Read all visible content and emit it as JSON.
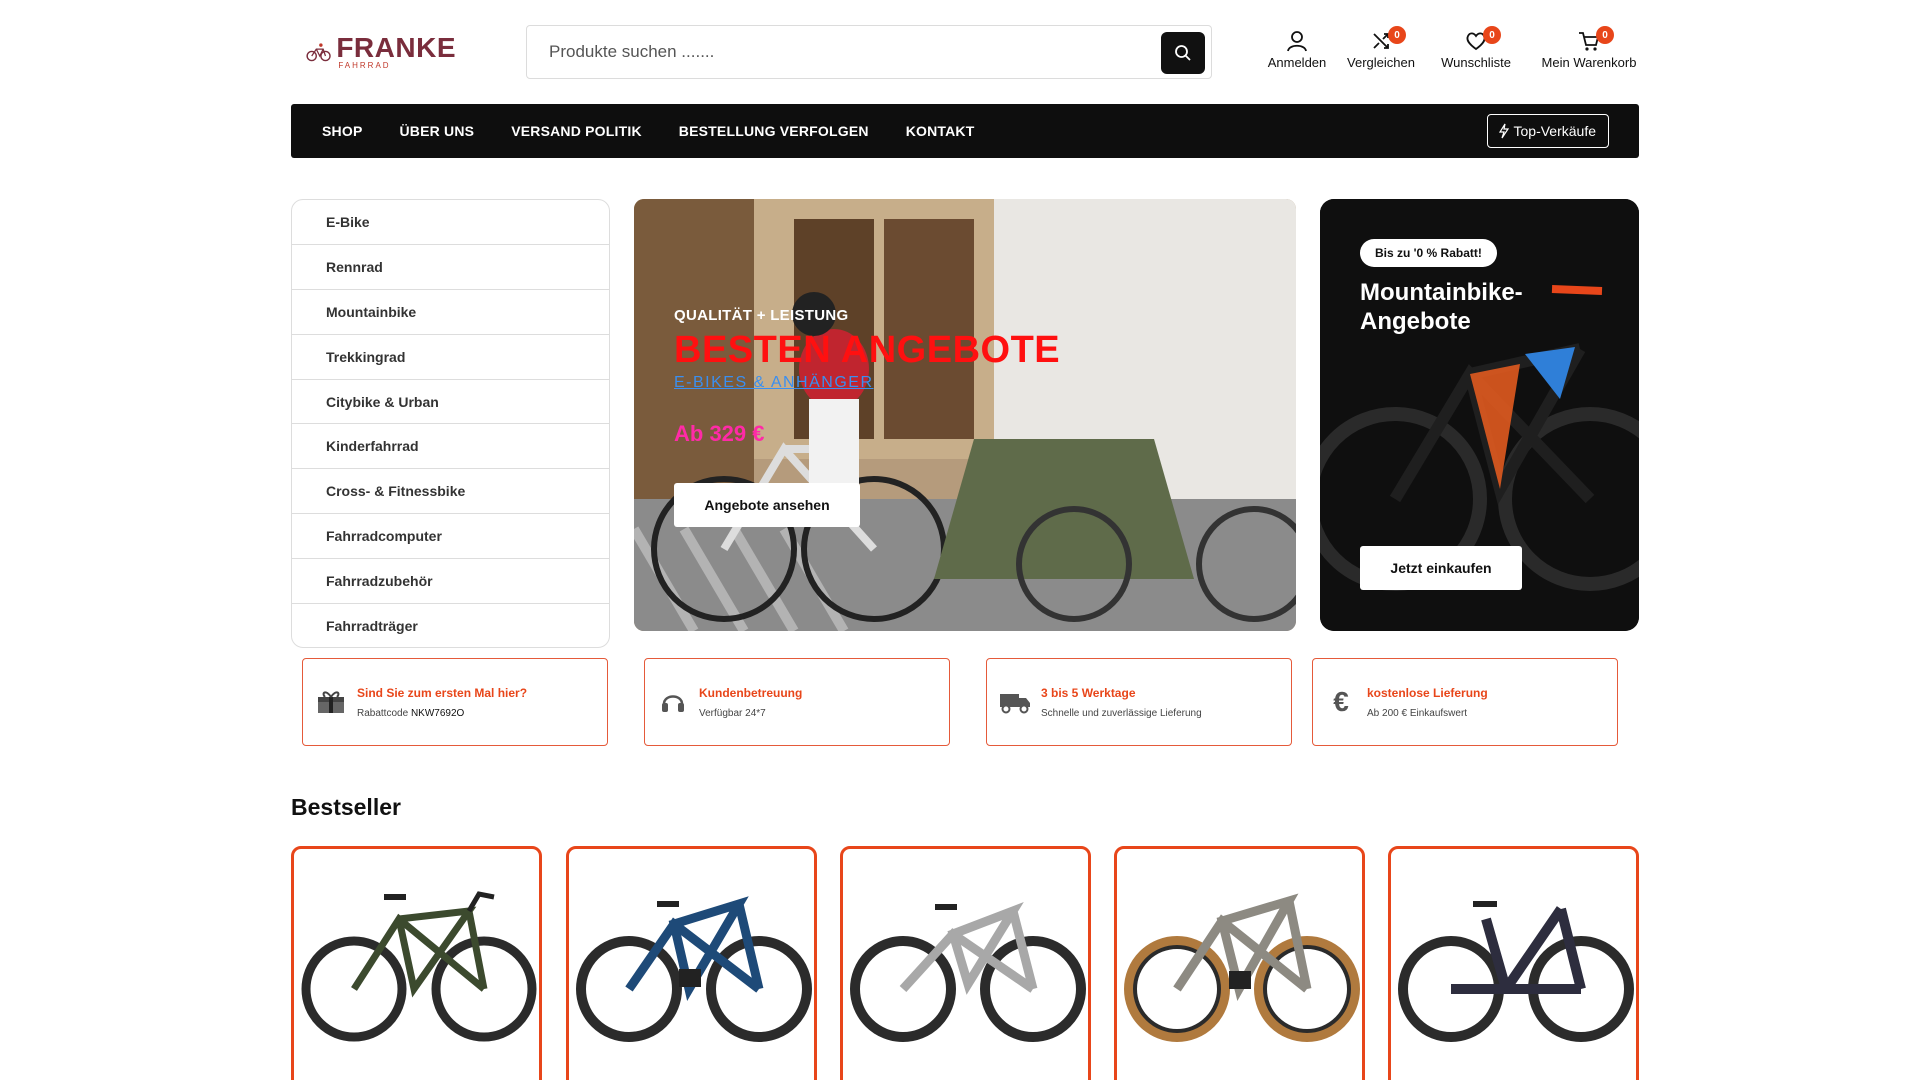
{
  "logo": {
    "name": "FRANKE",
    "sub": "FAHRRAD"
  },
  "search": {
    "placeholder": "Produkte suchen ......."
  },
  "header_actions": [
    {
      "label": "Anmelden",
      "icon": "user-icon"
    },
    {
      "label": "Vergleichen",
      "icon": "compare-icon",
      "count": "0"
    },
    {
      "label": "Wunschliste",
      "icon": "heart-icon",
      "count": "0"
    },
    {
      "label": "Mein Warenkorb",
      "icon": "cart-icon",
      "count": "0"
    }
  ],
  "nav": {
    "items": [
      "SHOP",
      "ÜBER UNS",
      "VERSAND POLITIK",
      "BESTELLUNG VERFOLGEN",
      "KONTAKT"
    ],
    "top_sellers": "Top-Verkäufe"
  },
  "categories": [
    "E-Bike",
    "Rennrad",
    "Mountainbike",
    "Trekkingrad",
    "Citybike & Urban",
    "Kinderfahrrad",
    "Cross- & Fitnessbike",
    "Fahrradcomputer",
    "Fahrradzubehör",
    "Fahrradträger"
  ],
  "hero": {
    "kicker": "QUALITÄT + LEISTUNG",
    "headline": "BESTEN ANGEBOTE",
    "link": "E-BIKES & ANHÄNGER",
    "price": "Ab 329 €",
    "button": "Angebote ansehen"
  },
  "promo": {
    "badge": "Bis zu '0 % Rabatt!",
    "title": "Mountainbike-Angebote",
    "button": "Jetzt einkaufen"
  },
  "features": [
    {
      "title": "Sind Sie zum ersten Mal hier?",
      "sub": "Rabattcode ",
      "code": "NKW7692O",
      "icon": "gift-icon"
    },
    {
      "title": "Kundenbetreuung",
      "sub": "Verfügbar 24*7",
      "code": "",
      "icon": "headset-icon"
    },
    {
      "title": "3 bis 5 Werktage",
      "sub": "Schnelle und zuverlässige Lieferung",
      "code": "",
      "icon": "truck-icon"
    },
    {
      "title": "kostenlose Lieferung",
      "sub": "Ab 200 € Einkaufswert",
      "code": "",
      "icon": "euro-icon"
    }
  ],
  "bestseller": {
    "title": "Bestseller"
  },
  "colors": {
    "accent": "#e8461a",
    "nav_bg": "#0e0e0e",
    "hero_headline": "#ff1010",
    "hero_link": "#3a8ff0",
    "hero_price": "#ff2aa7"
  }
}
